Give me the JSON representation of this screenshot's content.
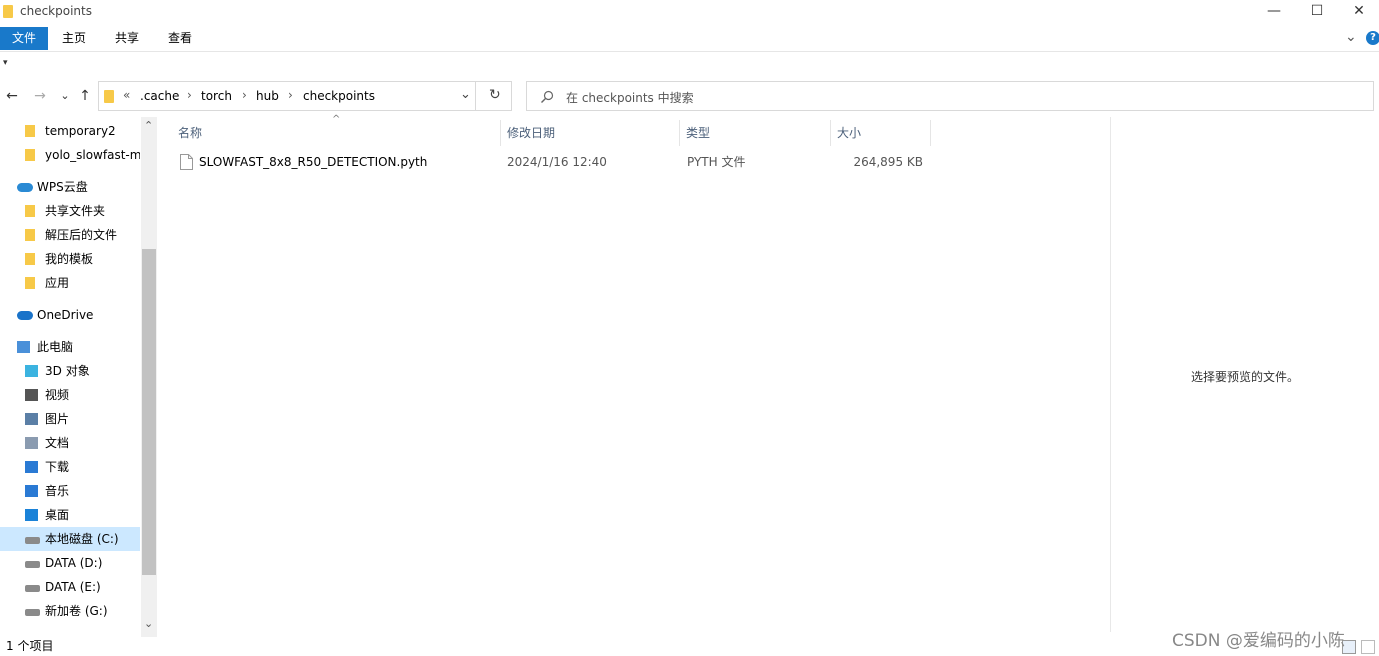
{
  "window": {
    "title": "checkpoints",
    "controls": {
      "minimize": "—",
      "maximize": "☐",
      "close": "✕"
    }
  },
  "ribbon": {
    "tabs": [
      "文件",
      "主页",
      "共享",
      "查看"
    ],
    "help_icon": "?",
    "expand_icon": "⌄"
  },
  "quick_access": {
    "dropdown": "▾"
  },
  "navigation": {
    "back": "←",
    "forward": "→",
    "recent": "⌄",
    "up": "↑",
    "breadcrumb_overflow": "«",
    "breadcrumbs": [
      ".cache",
      "torch",
      "hub",
      "checkpoints"
    ],
    "breadcrumb_separator": "›",
    "address_dropdown": "⌄",
    "refresh": "↻",
    "search_placeholder": "在 checkpoints 中搜索"
  },
  "sidebar": {
    "items": [
      {
        "label": "temporary2",
        "icon": "folder-icon",
        "indent": 1
      },
      {
        "label": "yolo_slowfast-ma",
        "icon": "folder-icon",
        "indent": 1
      },
      {
        "label": "WPS云盘",
        "icon": "cloud-icon",
        "indent": 0
      },
      {
        "label": "共享文件夹",
        "icon": "shared-folder-icon",
        "indent": 1
      },
      {
        "label": "解压后的文件",
        "icon": "folder-icon",
        "indent": 1
      },
      {
        "label": "我的模板",
        "icon": "folder-icon",
        "indent": 1
      },
      {
        "label": "应用",
        "icon": "app-folder-icon",
        "indent": 1
      },
      {
        "label": "OneDrive",
        "icon": "onedrive-icon",
        "indent": 0
      },
      {
        "label": "此电脑",
        "icon": "computer-icon",
        "indent": 0
      },
      {
        "label": "3D 对象",
        "icon": "3d-objects-icon",
        "indent": 1
      },
      {
        "label": "视频",
        "icon": "video-icon",
        "indent": 1
      },
      {
        "label": "图片",
        "icon": "pictures-icon",
        "indent": 1
      },
      {
        "label": "文档",
        "icon": "documents-icon",
        "indent": 1
      },
      {
        "label": "下载",
        "icon": "download-icon",
        "indent": 1
      },
      {
        "label": "音乐",
        "icon": "music-icon",
        "indent": 1
      },
      {
        "label": "桌面",
        "icon": "desktop-icon",
        "indent": 1
      },
      {
        "label": "本地磁盘 (C:)",
        "icon": "windows-drive-icon",
        "indent": 1,
        "selected": true
      },
      {
        "label": "DATA (D:)",
        "icon": "drive-icon",
        "indent": 1
      },
      {
        "label": "DATA (E:)",
        "icon": "drive-icon",
        "indent": 1
      },
      {
        "label": "新加卷 (G:)",
        "icon": "drive-icon",
        "indent": 1
      }
    ],
    "scroll_up": "⌃",
    "scroll_down": "⌄"
  },
  "file_list": {
    "columns": [
      "名称",
      "修改日期",
      "类型",
      "大小"
    ],
    "sort_indicator": "^",
    "files": [
      {
        "name": "SLOWFAST_8x8_R50_DETECTION.pyth",
        "modified": "2024/1/16 12:40",
        "type": "PYTH 文件",
        "size": "264,895 KB"
      }
    ]
  },
  "preview": {
    "message": "选择要预览的文件。"
  },
  "status": {
    "item_count": "1 个项目"
  },
  "watermark": "CSDN @爱编码的小陈",
  "colors": {
    "accent": "#1979ca",
    "selection": "#cce8ff",
    "folder": "#f7c948",
    "header_text": "#4c607a"
  }
}
